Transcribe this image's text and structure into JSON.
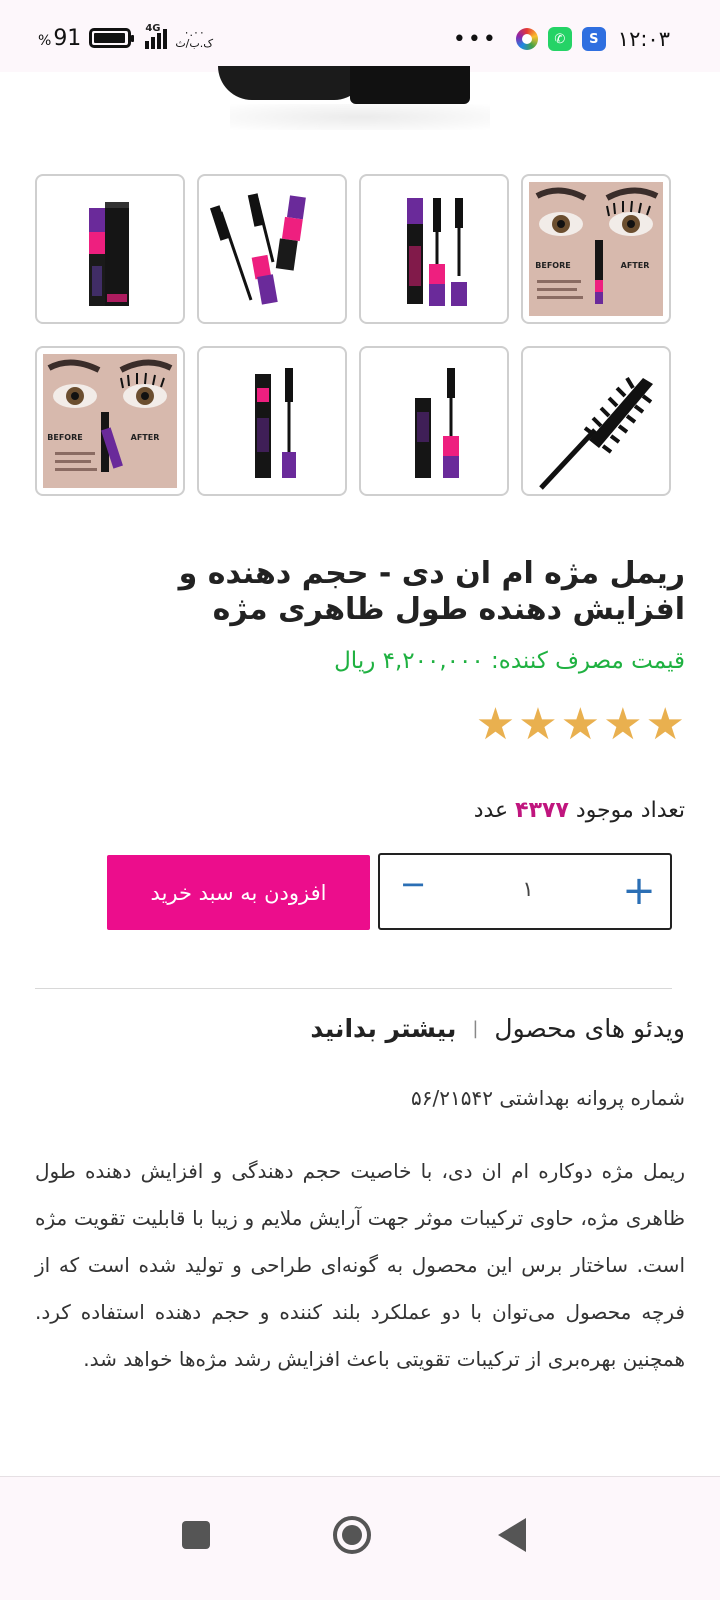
{
  "status_bar": {
    "battery_percent": "91",
    "percent_sign": "%",
    "network": "4G",
    "speed_value": "۰.۰۰",
    "speed_unit": "ک.ب/ث",
    "time": "۱۲:۰۳",
    "more": "•••"
  },
  "product": {
    "title": "ریمل مژه ام ان دی - حجم دهنده و افزایش دهنده طول ظاهری مژه",
    "price": "قیمت مصرف کننده: ۴,۲۰۰,۰۰۰ ریال",
    "rating": 5,
    "stars": [
      "★",
      "★",
      "★",
      "★",
      "★"
    ],
    "stock_prefix": "تعداد موجود",
    "stock_count": "۴۳۷۷",
    "stock_suffix": "عدد"
  },
  "thumbnail_labels": {
    "before": "BEFORE",
    "after": "AFTER"
  },
  "quantity": {
    "value": "۱",
    "minus": "−",
    "plus": "+"
  },
  "actions": {
    "add_to_cart": "افزودن به سبد خرید"
  },
  "tabs": {
    "learn_more": "بیشتر بدانید",
    "separator": "|",
    "videos": "ویدئو های محصول"
  },
  "content": {
    "license": "شماره پروانه بهداشتی ۵۶/۲۱۵۴۲",
    "description": "ریمل مژه دوکاره ام ان دی، با خاصیت حجم دهندگی و افزایش دهنده طول ظاهری مژه، حاوی ترکیبات موثر جهت آرایش ملایم و زیبا با قابلیت تقویت مژه است. ساختار برس این محصول به گونه‌ای طراحی و تولید شده است که از فرچه محصول می‌توان با دو عملکرد بلند کننده و حجم دهنده استفاده کرد. همچنین بهره‌بری از ترکیبات تقویتی باعث افزایش رشد مژه‌ها خواهد شد."
  },
  "colors": {
    "accent_pink": "#ec0d8c",
    "price_green": "#1fb141",
    "star_gold": "#e9b04f",
    "stock_magenta": "#c0157e",
    "stepper_blue": "#2b6fb5"
  }
}
